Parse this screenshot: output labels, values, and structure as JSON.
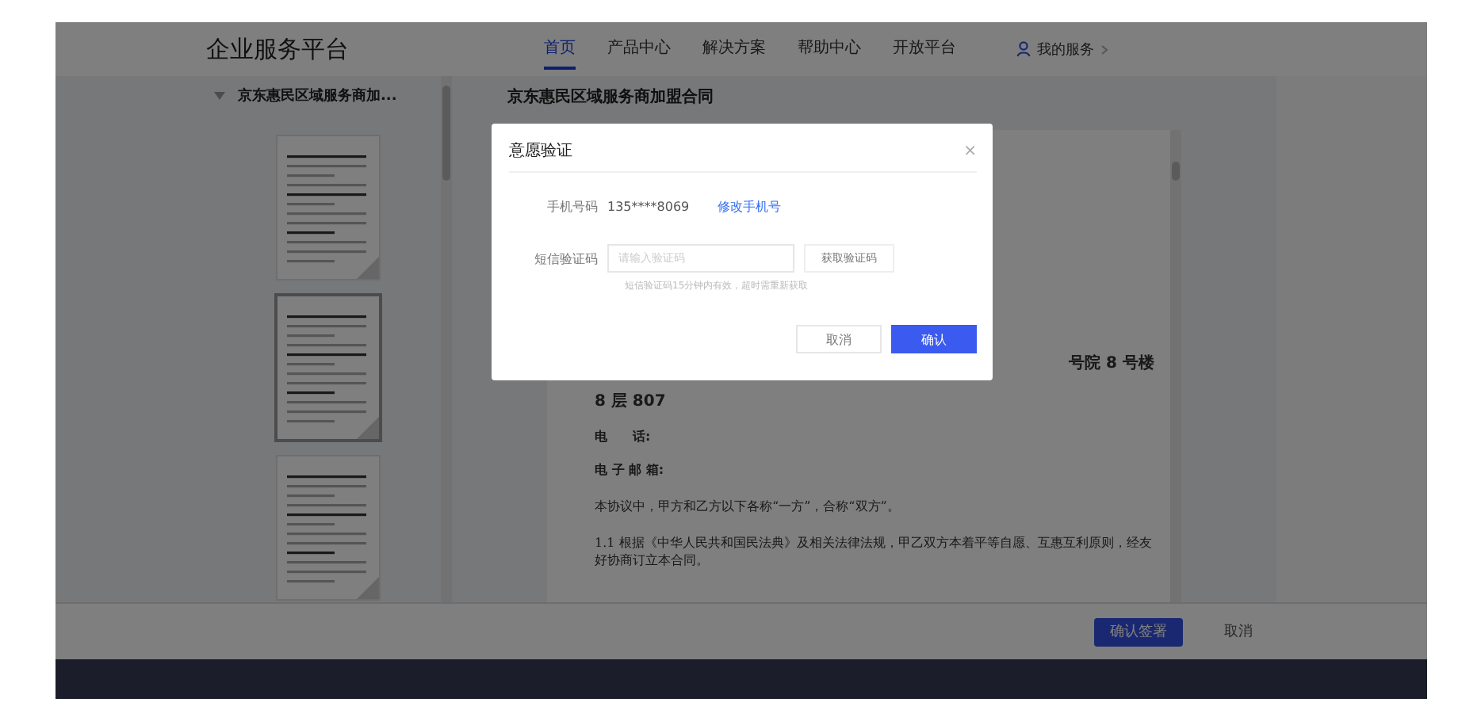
{
  "header": {
    "logo": "企业服务平台",
    "nav": [
      {
        "label": "首页",
        "selected": true
      },
      {
        "label": "产品中心",
        "selected": false
      },
      {
        "label": "解决方案",
        "selected": false
      },
      {
        "label": "帮助中心",
        "selected": false
      },
      {
        "label": "开放平台",
        "selected": false
      }
    ],
    "user_menu": "我的服务"
  },
  "sidebar": {
    "document_title": "京东惠民区域服务商加...",
    "expanded": true,
    "pages": [
      {
        "selected": false
      },
      {
        "selected": true
      },
      {
        "selected": false
      }
    ]
  },
  "document": {
    "title": "京东惠民区域服务商加盟合同",
    "lines": [
      {
        "kind": "fragment",
        "text": "号院 8 号楼"
      },
      {
        "kind": "plain",
        "text": "8 层 807"
      },
      {
        "kind": "field",
        "text": "电　　话:"
      },
      {
        "kind": "field",
        "text": "电 子 邮 箱:"
      },
      {
        "kind": "body",
        "text": "本协议中，甲方和乙方以下各称“一方”，合称“双方”。"
      },
      {
        "kind": "body",
        "text": "1.1 根据《中华人民共和国民法典》及相关法律法规，甲乙双方本着平等自愿、互惠互利原则，经友好协商订立本合同。"
      }
    ]
  },
  "footer_buttons": [
    {
      "label": "确认签署",
      "primary": true
    },
    {
      "label": "取消",
      "primary": false
    }
  ],
  "dialog": {
    "title": "意愿验证",
    "close": "×",
    "phone_label": "手机号码",
    "phone": "135****8069",
    "change_phone": "修改手机号",
    "code_label": "短信验证码",
    "code_placeholder": "请输入验证码",
    "get_code": "获取验证码",
    "hint": "短信验证码15分钟内有效，超时需重新获取",
    "buttons": [
      {
        "label": "取消",
        "primary": false
      },
      {
        "label": "确认",
        "primary": true
      }
    ]
  }
}
